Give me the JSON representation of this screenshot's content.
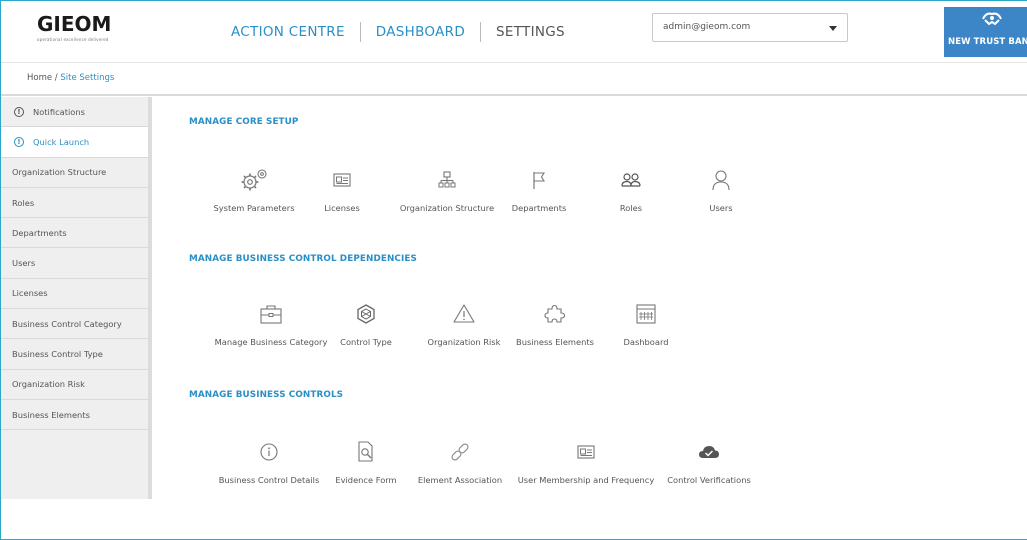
{
  "header": {
    "logo_text": "GIEOM",
    "logo_tagline": "operational excellence delivered",
    "nav": {
      "action_centre": "ACTION CENTRE",
      "dashboard": "DASHBOARD",
      "settings": "SETTINGS"
    },
    "user_select": {
      "value": "admin@gieom.com"
    },
    "bank_name": "NEW TRUST BANK"
  },
  "breadcrumb": {
    "home": "Home",
    "separator": " / ",
    "current": "Site Settings"
  },
  "sidebar": {
    "items": [
      {
        "label": "Notifications",
        "icon": "info-icon",
        "active": false
      },
      {
        "label": "Quick Launch",
        "icon": "info-icon",
        "active": true
      },
      {
        "label": "Organization Structure"
      },
      {
        "label": "Roles"
      },
      {
        "label": "Departments"
      },
      {
        "label": "Users"
      },
      {
        "label": "Licenses"
      },
      {
        "label": "Business Control Category"
      },
      {
        "label": "Business Control Type"
      },
      {
        "label": "Organization Risk"
      },
      {
        "label": "Business Elements"
      }
    ]
  },
  "sections": [
    {
      "title": "MANAGE CORE SETUP",
      "tiles": [
        {
          "label": "System Parameters",
          "icon": "gears-icon"
        },
        {
          "label": "Licenses",
          "icon": "license-card-icon"
        },
        {
          "label": "Organization Structure",
          "icon": "org-chart-icon"
        },
        {
          "label": "Departments",
          "icon": "flag-icon"
        },
        {
          "label": "Roles",
          "icon": "people-icon"
        },
        {
          "label": "Users",
          "icon": "user-icon"
        }
      ]
    },
    {
      "title": "MANAGE BUSINESS CONTROL DEPENDENCIES",
      "tiles": [
        {
          "label": "Manage Business Category",
          "icon": "briefcase-icon"
        },
        {
          "label": "Control Type",
          "icon": "hexagon-icon"
        },
        {
          "label": "Organization Risk",
          "icon": "warning-icon"
        },
        {
          "label": "Business Elements",
          "icon": "puzzle-icon"
        },
        {
          "label": "Dashboard",
          "icon": "calendar-icon"
        }
      ]
    },
    {
      "title": "MANAGE BUSINESS CONTROLS",
      "tiles": [
        {
          "label": "Business Control Details",
          "icon": "info-circle-icon"
        },
        {
          "label": "Evidence Form",
          "icon": "document-search-icon"
        },
        {
          "label": "Element Association",
          "icon": "link-icon"
        },
        {
          "label": "User Membership and Frequency",
          "icon": "license-card-icon"
        },
        {
          "label": "Control Verifications",
          "icon": "cloud-check-icon"
        }
      ]
    }
  ],
  "colors": {
    "accent": "#2a8fc6",
    "bank_bg": "#3c86c8",
    "sidebar_bg": "#efefef",
    "border_accent": "#2aa8c9"
  }
}
